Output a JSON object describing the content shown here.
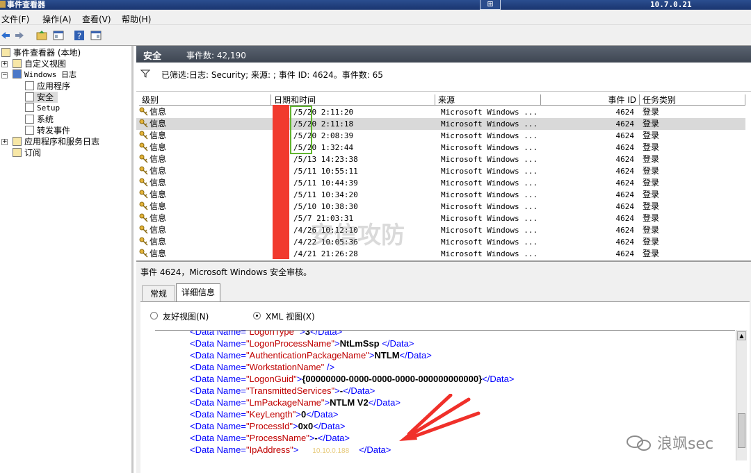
{
  "window": {
    "title": "事件查看器",
    "ip": "10.7.0.21",
    "pin_icon": "pin-icon"
  },
  "menu": [
    {
      "label": "文件(F)"
    },
    {
      "label": "操作(A)"
    },
    {
      "label": "查看(V)"
    },
    {
      "label": "帮助(H)"
    }
  ],
  "toolbar": {
    "icons": [
      "back-arrow-icon",
      "forward-arrow-icon",
      "up-folder-icon",
      "console-tree-icon",
      "help-icon",
      "action-pane-icon"
    ]
  },
  "tree": {
    "root": "事件查看器 (本地)",
    "custom_views": "自定义视图",
    "windows_logs": "Windows 日志",
    "application": "应用程序",
    "security": "安全",
    "setup": "Setup",
    "system": "系统",
    "forwarded": "转发事件",
    "app_services": "应用程序和服务日志",
    "subscriptions": "订阅"
  },
  "header": {
    "log_name": "安全",
    "event_count": "事件数: 42,190"
  },
  "filter": {
    "text": "已筛选:日志: Security; 来源: ; 事件 ID: 4624。事件数: 65"
  },
  "columns": {
    "level": "级别",
    "datetime": "日期和时间",
    "source": "来源",
    "event_id": "事件 ID",
    "task": "任务类别"
  },
  "events": [
    {
      "level": "信息",
      "datetime": "/5/20 2:11:20",
      "source": "Microsoft Windows ...",
      "event_id": "4624",
      "task": "登录"
    },
    {
      "level": "信息",
      "datetime": "/5/20 2:11:18",
      "source": "Microsoft Windows ...",
      "event_id": "4624",
      "task": "登录"
    },
    {
      "level": "信息",
      "datetime": "/5/20 2:08:39",
      "source": "Microsoft Windows ...",
      "event_id": "4624",
      "task": "登录"
    },
    {
      "level": "信息",
      "datetime": "/5/20 1:32:44",
      "source": "Microsoft Windows ...",
      "event_id": "4624",
      "task": "登录"
    },
    {
      "level": "信息",
      "datetime": "/5/13 14:23:38",
      "source": "Microsoft Windows ...",
      "event_id": "4624",
      "task": "登录"
    },
    {
      "level": "信息",
      "datetime": "/5/11 10:55:11",
      "source": "Microsoft Windows ...",
      "event_id": "4624",
      "task": "登录"
    },
    {
      "level": "信息",
      "datetime": "/5/11 10:44:39",
      "source": "Microsoft Windows ...",
      "event_id": "4624",
      "task": "登录"
    },
    {
      "level": "信息",
      "datetime": "/5/11 10:34:20",
      "source": "Microsoft Windows ...",
      "event_id": "4624",
      "task": "登录"
    },
    {
      "level": "信息",
      "datetime": "/5/10 10:38:30",
      "source": "Microsoft Windows ...",
      "event_id": "4624",
      "task": "登录"
    },
    {
      "level": "信息",
      "datetime": "/5/7 21:03:31",
      "source": "Microsoft Windows ...",
      "event_id": "4624",
      "task": "登录"
    },
    {
      "level": "信息",
      "datetime": "/4/26 10:12:10",
      "source": "Microsoft Windows ...",
      "event_id": "4624",
      "task": "登录"
    },
    {
      "level": "信息",
      "datetime": "/4/22 10:05:36",
      "source": "Microsoft Windows ...",
      "event_id": "4624",
      "task": "登录"
    },
    {
      "level": "信息",
      "datetime": "/4/21 21:26:28",
      "source": "Microsoft Windows ...",
      "event_id": "4624",
      "task": "登录"
    }
  ],
  "detail": {
    "title": "事件 4624，Microsoft Windows 安全审核。",
    "tab_general": "常规",
    "tab_details": "详细信息",
    "radio_friendly": "友好视图(N)",
    "radio_xml": "XML 视图(X)",
    "xml_lines": [
      {
        "open": "<Data Name=",
        "name": "\"LogonType\"",
        "mid": " >",
        "value": "3",
        "close": "</Data>"
      },
      {
        "open": "<Data Name=",
        "name": "\"LogonProcessName\"",
        "mid": ">",
        "value": "NtLmSsp ",
        "close": "</Data>"
      },
      {
        "open": "<Data Name=",
        "name": "\"AuthenticationPackageName\"",
        "mid": ">",
        "value": "NTLM",
        "close": "</Data>"
      },
      {
        "open": "<Data Name=",
        "name": "\"WorkstationName\"",
        "mid": " />",
        "value": "",
        "close": ""
      },
      {
        "open": "<Data Name=",
        "name": "\"LogonGuid\"",
        "mid": ">",
        "value": "{00000000-0000-0000-0000-000000000000}",
        "close": "</Data>"
      },
      {
        "open": "<Data Name=",
        "name": "\"TransmittedServices\"",
        "mid": ">",
        "value": "-",
        "close": "</Data>"
      },
      {
        "open": "<Data Name=",
        "name": "\"LmPackageName\"",
        "mid": ">",
        "value": "NTLM V2",
        "close": "</Data>"
      },
      {
        "open": "<Data Name=",
        "name": "\"KeyLength\"",
        "mid": ">",
        "value": "0",
        "close": "</Data>"
      },
      {
        "open": "<Data Name=",
        "name": "\"ProcessId\"",
        "mid": ">",
        "value": "0x0",
        "close": "</Data>"
      },
      {
        "open": "<Data Name=",
        "name": "\"ProcessName\"",
        "mid": ">",
        "value": "-",
        "close": "</Data>"
      },
      {
        "open": "<Data Name=",
        "name": "\"IpAddress\"",
        "mid": ">",
        "value": "10.10.0.188",
        "close": "</Data>"
      }
    ]
  },
  "watermark": {
    "brand": "安信攻防",
    "account": "浪飒sec"
  },
  "colors": {
    "redaction": "#f13a2e",
    "highlight_box": "#61b52f",
    "arrow": "#f0302a",
    "ip_value": "#e6c97a"
  }
}
